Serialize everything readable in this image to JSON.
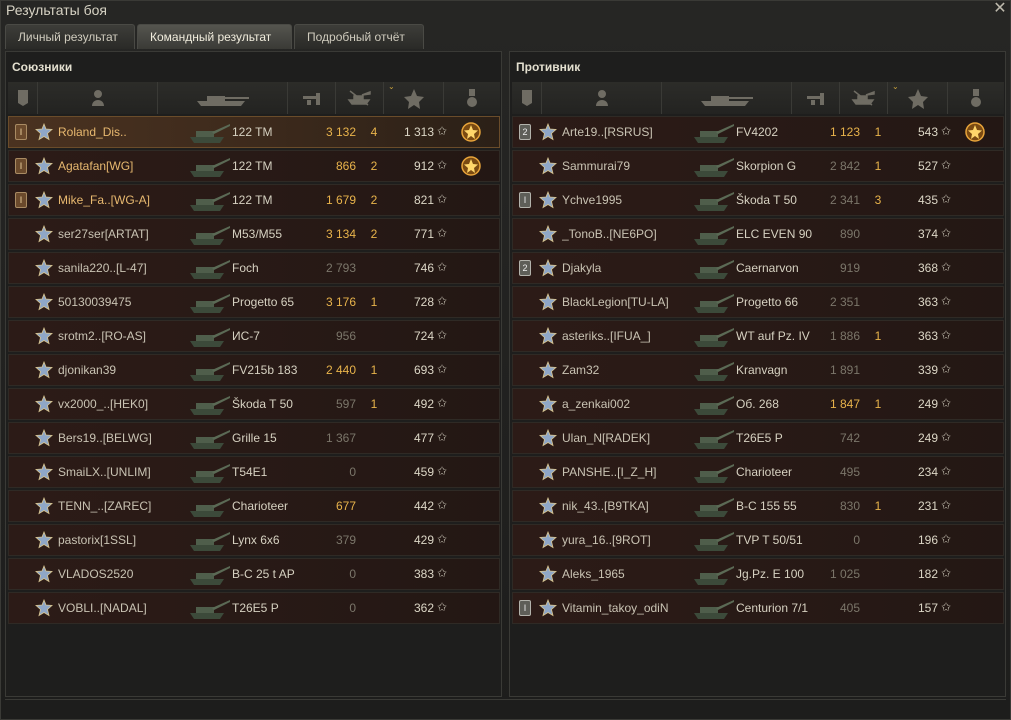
{
  "window": {
    "title": "Результаты боя",
    "close_icon": "close-icon"
  },
  "tabs": [
    {
      "label": "Личный результат"
    },
    {
      "label": "Командный результат",
      "active": true
    },
    {
      "label": "Подробный отчёт"
    }
  ],
  "allies": {
    "title": "Союзники",
    "players": [
      {
        "rank": "I",
        "name": "Roland_Dis..",
        "vehicle": "122 TM",
        "damage": "3 132",
        "frags": "4",
        "xp": "1 313",
        "medal": true,
        "me": true,
        "platoon": true
      },
      {
        "rank": "I",
        "name": "Agatafan[WG]",
        "vehicle": "122 TM",
        "damage": "866",
        "frags": "2",
        "xp": "912",
        "medal": true,
        "platoon": true
      },
      {
        "rank": "I",
        "name": "Mike_Fa..[WG-A]",
        "vehicle": "122 TM",
        "damage": "1 679",
        "frags": "2",
        "xp": "821",
        "platoon": true
      },
      {
        "name": "ser27ser[ARTAT]",
        "vehicle": "M53/M55",
        "damage": "3 134",
        "frags": "2",
        "xp": "771"
      },
      {
        "name": "sanila220..[L-47]",
        "vehicle": "Foch",
        "damage": "2 793",
        "frags": "",
        "xp": "746",
        "low": true
      },
      {
        "name": "50130039475",
        "vehicle": "Progetto 65",
        "damage": "3 176",
        "frags": "1",
        "xp": "728"
      },
      {
        "name": "srotm2..[RO-AS]",
        "vehicle": "ИС-7",
        "damage": "956",
        "frags": "",
        "xp": "724",
        "low": true
      },
      {
        "name": "djonikan39",
        "vehicle": "FV215b 183",
        "damage": "2 440",
        "frags": "1",
        "xp": "693"
      },
      {
        "name": "vx2000_..[HEK0]",
        "vehicle": "Škoda T 50",
        "damage": "597",
        "frags": "1",
        "xp": "492",
        "low": true
      },
      {
        "name": "Bers19..[BELWG]",
        "vehicle": "Grille 15",
        "damage": "1 367",
        "frags": "",
        "xp": "477",
        "low": true
      },
      {
        "name": "SmaiLX..[UNLIM]",
        "vehicle": "T54E1",
        "damage": "0",
        "frags": "",
        "xp": "459",
        "low": true
      },
      {
        "name": "TENN_..[ZAREC]",
        "vehicle": "Charioteer",
        "damage": "677",
        "frags": "",
        "xp": "442"
      },
      {
        "name": "pastorix[1SSL]",
        "vehicle": "Lynx 6x6",
        "damage": "379",
        "frags": "",
        "xp": "429",
        "low": true
      },
      {
        "name": "VLADOS2520",
        "vehicle": "B-C 25 t AP",
        "damage": "0",
        "frags": "",
        "xp": "383",
        "low": true
      },
      {
        "name": "VOBLI..[NADAL]",
        "vehicle": "T26E5 P",
        "damage": "0",
        "frags": "",
        "xp": "362",
        "low": true
      }
    ]
  },
  "enemies": {
    "title": "Противник",
    "players": [
      {
        "rank": "2",
        "rank_silver": true,
        "name": "Arte19..[RSRUS]",
        "vehicle": "FV4202",
        "damage": "1 123",
        "frags": "1",
        "xp": "543",
        "medal": true
      },
      {
        "name": "Sammurai79",
        "vehicle": "Skorpion G",
        "damage": "2 842",
        "frags": "1",
        "xp": "527",
        "low": true
      },
      {
        "rank": "I",
        "rank_silver": true,
        "name": "Ychve1995",
        "vehicle": "Škoda T 50",
        "damage": "2 341",
        "frags": "3",
        "xp": "435",
        "low": true
      },
      {
        "name": "_TonoB..[NE6PO]",
        "vehicle": "ELC EVEN 90",
        "damage": "890",
        "frags": "",
        "xp": "374",
        "low": true
      },
      {
        "rank": "2",
        "rank_silver": true,
        "name": "Djakyla",
        "vehicle": "Caernarvon",
        "damage": "919",
        "frags": "",
        "xp": "368",
        "low": true
      },
      {
        "name": "BlackLegion[TU-LA]",
        "vehicle": "Progetto 66",
        "damage": "2 351",
        "frags": "",
        "xp": "363",
        "low": true
      },
      {
        "name": "asteriks..[IFUA_]",
        "vehicle": "WT auf Pz. IV",
        "damage": "1 886",
        "frags": "1",
        "xp": "363",
        "low": true
      },
      {
        "name": "Zam32",
        "vehicle": "Kranvagn",
        "damage": "1 891",
        "frags": "",
        "xp": "339",
        "low": true
      },
      {
        "name": "a_zenkai002",
        "vehicle": "Об. 268",
        "damage": "1 847",
        "frags": "1",
        "xp": "249"
      },
      {
        "name": "Ulan_N[RADEK]",
        "vehicle": "T26E5 P",
        "damage": "742",
        "frags": "",
        "xp": "249",
        "low": true
      },
      {
        "name": "PANSHE..[I_Z_H]",
        "vehicle": "Charioteer",
        "damage": "495",
        "frags": "",
        "xp": "234",
        "low": true
      },
      {
        "name": "nik_43..[B9TKA]",
        "vehicle": "B-C 155 55",
        "damage": "830",
        "frags": "1",
        "xp": "231",
        "low": true
      },
      {
        "name": "yura_16..[9ROT]",
        "vehicle": "TVP T 50/51",
        "damage": "0",
        "frags": "",
        "xp": "196",
        "low": true
      },
      {
        "name": "Aleks_1965",
        "vehicle": "Jg.Pz. E 100",
        "damage": "1 025",
        "frags": "",
        "xp": "182",
        "low": true
      },
      {
        "rank": "I",
        "rank_silver": true,
        "name": "Vitamin_takoy_odiN",
        "vehicle": "Centurion 7/1",
        "damage": "405",
        "frags": "",
        "xp": "157",
        "low": true
      }
    ]
  }
}
